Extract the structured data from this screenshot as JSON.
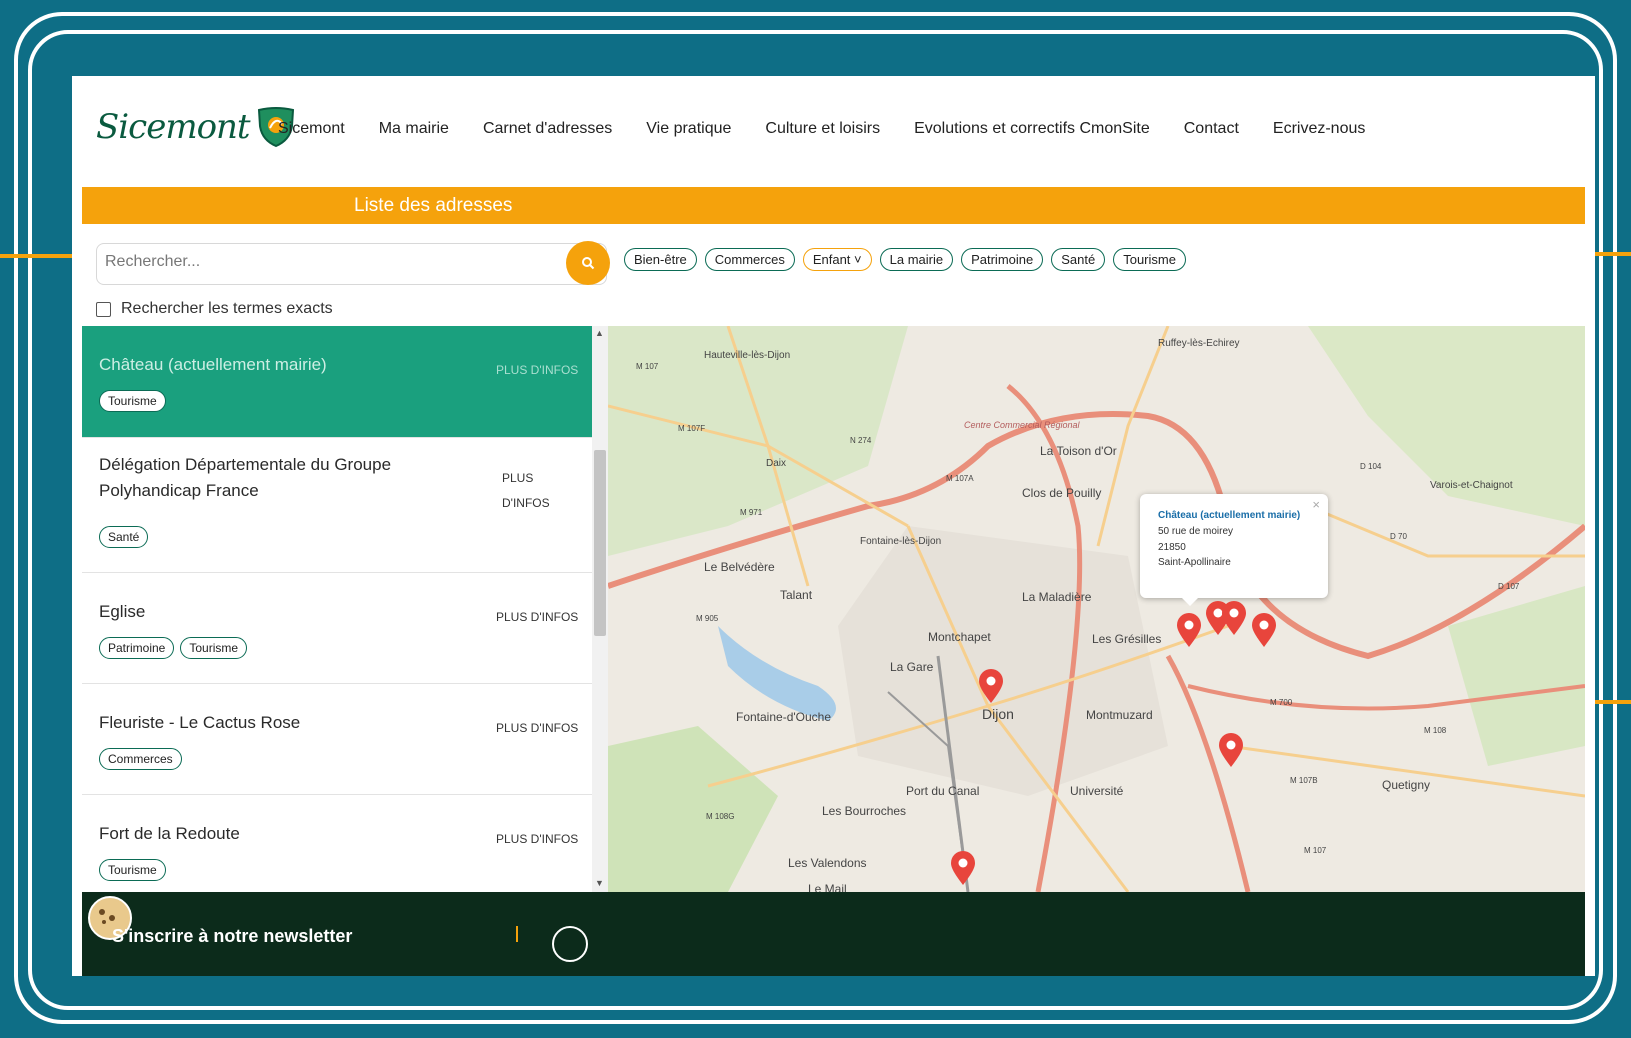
{
  "brand": {
    "name": "Sicemont"
  },
  "nav": {
    "items": [
      "Sicemont",
      "Ma mairie",
      "Carnet d'adresses",
      "Vie pratique",
      "Culture et loisirs",
      "Evolutions et correctifs CmonSite",
      "Contact",
      "Ecrivez-nous"
    ]
  },
  "page": {
    "title": "Liste des adresses"
  },
  "search": {
    "placeholder": "Rechercher...",
    "value": "",
    "exact_label": "Rechercher les termes exacts"
  },
  "filters": [
    "Bien-être",
    "Commerces",
    "Enfant ˅",
    "La mairie",
    "Patrimoine",
    "Santé",
    "Tourisme"
  ],
  "list": {
    "items": [
      {
        "title": "Château (actuellement mairie)",
        "more": "PLUS D'INFOS",
        "tags": [
          "Tourisme"
        ],
        "selected": true
      },
      {
        "title": "Délégation Départementale du Groupe Polyhandicap France",
        "more": "PLUS D'INFOS",
        "tags": [
          "Santé"
        ]
      },
      {
        "title": "Eglise",
        "more": "PLUS D'INFOS",
        "tags": [
          "Patrimoine",
          "Tourisme"
        ]
      },
      {
        "title": "Fleuriste - Le Cactus Rose",
        "more": "PLUS D'INFOS",
        "tags": [
          "Commerces"
        ]
      },
      {
        "title": "Fort de la Redoute",
        "more": "PLUS D'INFOS",
        "tags": [
          "Tourisme"
        ]
      }
    ]
  },
  "map": {
    "labels": [
      "Hauteville-lès-Dijon",
      "Ruffey-lès-Echirey",
      "Daix",
      "La Toison d'Or",
      "Clos de Pouilly",
      "Varois-et-Chaignot",
      "Fontaine-lès-Dijon",
      "Le Belvédère",
      "Talant",
      "La Maladière",
      "Montchapet",
      "Les Grésilles",
      "La Gare",
      "Dijon",
      "Montmuzard",
      "Fontaine-d'Ouche",
      "Port du Canal",
      "Université",
      "Quetigny",
      "Les Bourroches",
      "Les Valendons",
      "Le Mail",
      "Centre Commercial Régional",
      "M 107",
      "M 107F",
      "N 274",
      "M 107A",
      "M 971",
      "M 905",
      "D 104",
      "D 70",
      "M 700",
      "M 108",
      "M 107B",
      "M 108G",
      "M 107",
      "D 107"
    ],
    "popup": {
      "title": "Château (actuellement mairie)",
      "address": "50 rue de moirey",
      "postcode": "21850",
      "city": "Saint-Apollinaire"
    },
    "colors": {
      "marker": "#e8453c",
      "road_major": "#e98f7b",
      "road_minor": "#f6cf8e",
      "land": "#eeeae2",
      "park": "#cfe3b8",
      "water": "#a9cde8"
    }
  },
  "footer": {
    "newsletter": "S'inscrire à notre newsletter"
  },
  "theme": {
    "frame": "#0e6e86",
    "accent": "#f5a20c",
    "selected": "#1aa07e",
    "footer": "#0c2b1b"
  }
}
